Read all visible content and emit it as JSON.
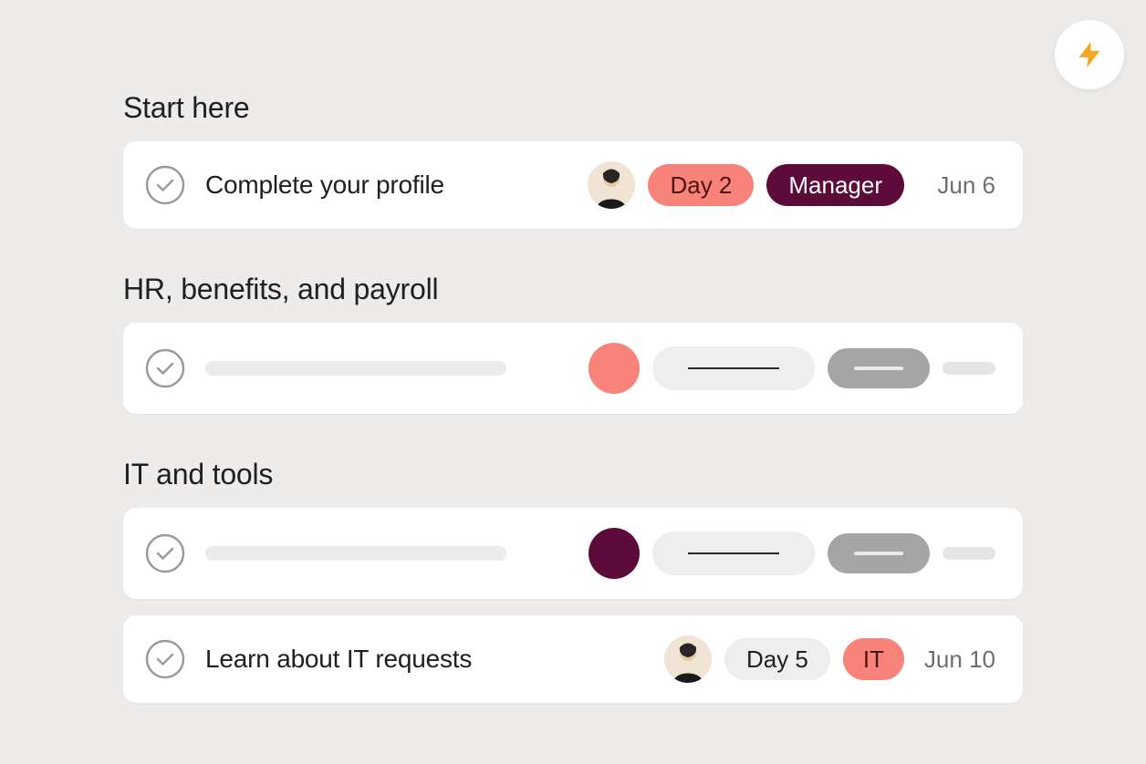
{
  "sections": {
    "start_here": {
      "title": "Start here",
      "task": {
        "title": "Complete your profile",
        "day_tag": "Day 2",
        "role_tag": "Manager",
        "due": "Jun 6"
      }
    },
    "hr": {
      "title": "HR, benefits, and payroll"
    },
    "it": {
      "title": "IT and tools",
      "task": {
        "title": "Learn about IT requests",
        "day_tag": "Day 5",
        "dept_tag": "IT",
        "due": "Jun 10"
      }
    }
  },
  "colors": {
    "salmon": "#f8837a",
    "plum": "#5c0b3a"
  }
}
